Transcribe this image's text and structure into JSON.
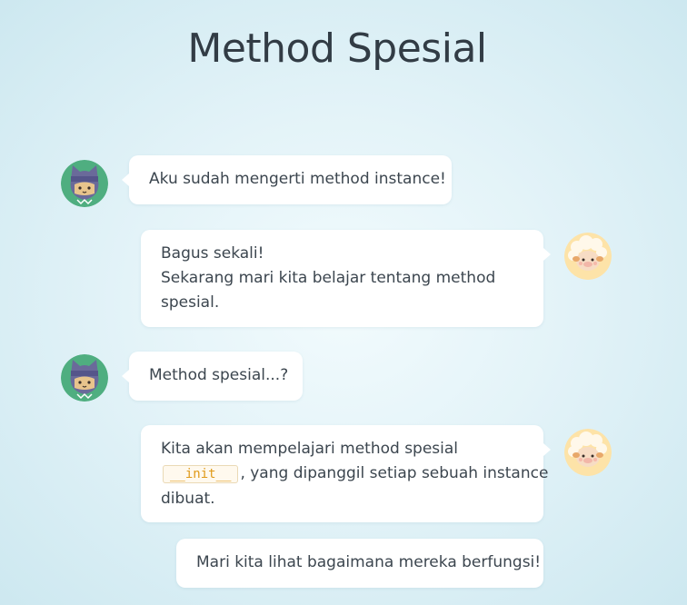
{
  "title": "Method Spesial",
  "avatars": {
    "cat": "cat-ninja-avatar-icon",
    "sheep": "sheep-avatar-icon"
  },
  "messages": [
    {
      "side": "left",
      "avatar": "cat",
      "lines": [
        "Aku sudah mengerti method instance!"
      ]
    },
    {
      "side": "right",
      "avatar": "sheep",
      "lines": [
        "Bagus sekali!",
        "Sekarang mari kita belajar tentang method",
        "spesial."
      ]
    },
    {
      "side": "left",
      "avatar": "cat",
      "lines": [
        "Method spesial...?"
      ]
    },
    {
      "side": "right",
      "avatar": "sheep",
      "line1": "Kita akan mempelajari method spesial",
      "code": "__init__",
      "line2_rest": ", yang dipanggil setiap sebuah instance",
      "line3": "dibuat."
    },
    {
      "side": "right",
      "avatar": "none",
      "lines": [
        "Mari kita lihat bagaimana mereka berfungsi!"
      ]
    }
  ],
  "colors": {
    "cat_bg": "#4fae80",
    "sheep_bg": "#fde3a8",
    "code_text": "#e09a1a"
  }
}
